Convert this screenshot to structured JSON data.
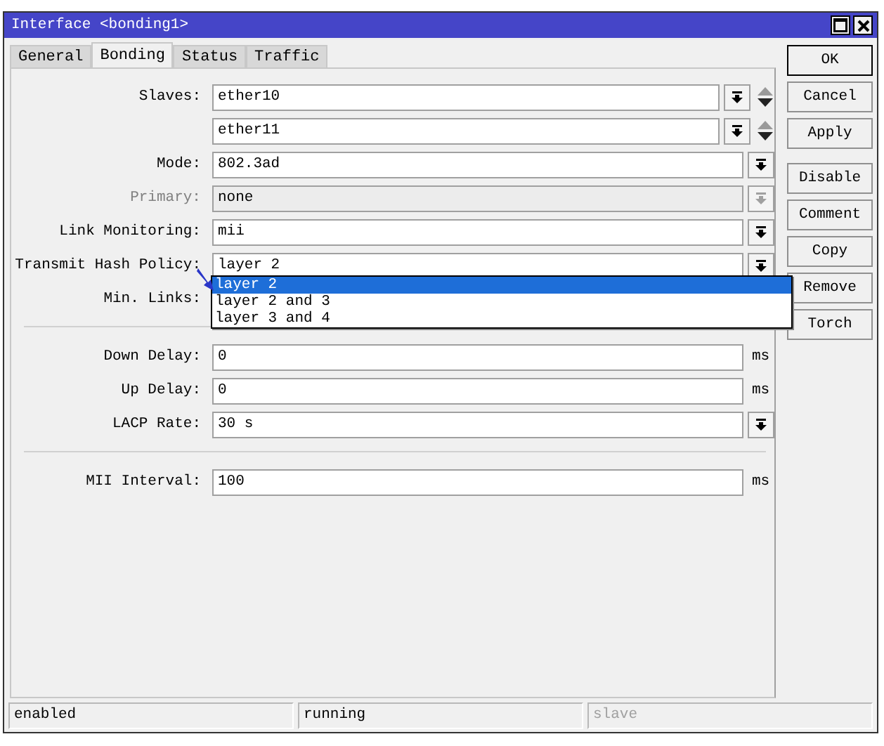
{
  "window": {
    "title": "Interface <bonding1>"
  },
  "tabs": [
    {
      "label": "General",
      "selected": false
    },
    {
      "label": "Bonding",
      "selected": true
    },
    {
      "label": "Status",
      "selected": false
    },
    {
      "label": "Traffic",
      "selected": false
    }
  ],
  "rows": [
    {
      "kind": "slave",
      "label": "Slaves:",
      "value": "ether10",
      "disabled": false
    },
    {
      "kind": "slave",
      "value": "ether11",
      "disabled": false
    },
    {
      "kind": "combo",
      "label": "Mode:",
      "value": "802.3ad",
      "disabled": false
    },
    {
      "kind": "combo",
      "label": "Primary:",
      "value": "none",
      "disabled": true
    },
    {
      "kind": "combo",
      "label": "Link Monitoring:",
      "value": "mii",
      "disabled": false
    },
    {
      "kind": "combo",
      "label": "Transmit Hash Policy:",
      "value": "layer 2",
      "disabled": false,
      "options": [
        {
          "label": "layer 2",
          "selected": true
        },
        {
          "label": "layer 2 and 3",
          "selected": false
        },
        {
          "label": "layer 3 and 4",
          "selected": false
        }
      ]
    },
    {
      "kind": "covered",
      "label": "Min. Links:"
    },
    {
      "kind": "separator"
    },
    {
      "kind": "text",
      "label": "Down Delay:",
      "value": "0",
      "unit": "ms"
    },
    {
      "kind": "text",
      "label": "Up Delay:",
      "value": "0",
      "unit": "ms"
    },
    {
      "kind": "combo",
      "label": "LACP Rate:",
      "value": "30 s",
      "disabled": false
    },
    {
      "kind": "separator"
    },
    {
      "kind": "text",
      "label": "MII Interval:",
      "value": "100",
      "unit": "ms"
    }
  ],
  "button_groups": [
    [
      {
        "label": "OK",
        "default": true
      },
      {
        "label": "Cancel",
        "default": false
      },
      {
        "label": "Apply",
        "default": false
      }
    ],
    [
      {
        "label": "Disable",
        "default": false
      },
      {
        "label": "Comment",
        "default": false
      },
      {
        "label": "Copy",
        "default": false
      },
      {
        "label": "Remove",
        "default": false
      },
      {
        "label": "Torch",
        "default": false
      }
    ]
  ],
  "status_bar": [
    {
      "text": "enabled",
      "disabled": false
    },
    {
      "text": "running",
      "disabled": false
    },
    {
      "text": "slave",
      "disabled": true
    }
  ]
}
